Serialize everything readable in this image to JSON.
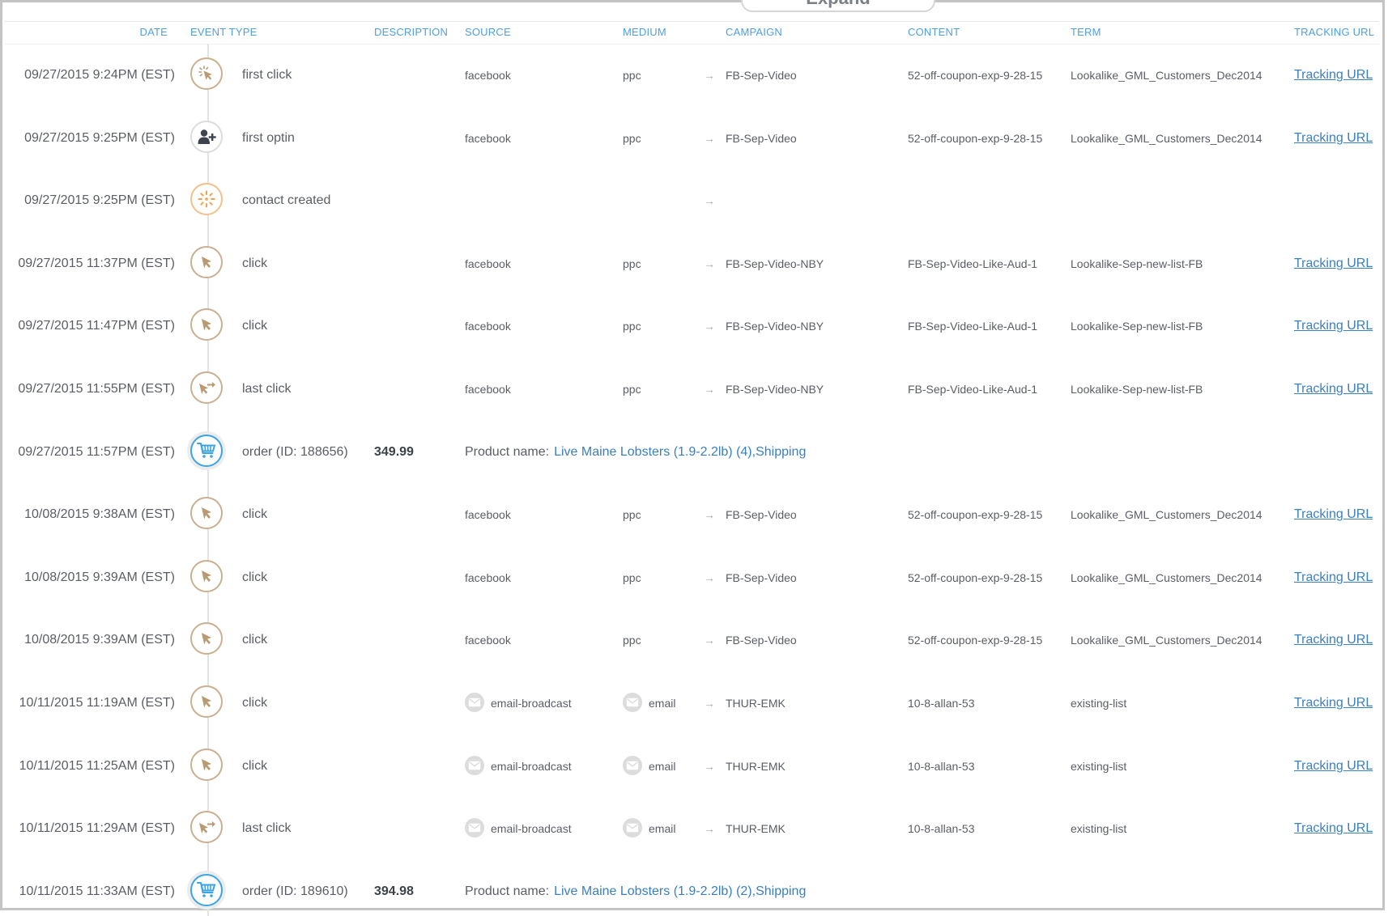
{
  "expand_button": {
    "label": "Expand"
  },
  "columns": {
    "date": "DATE",
    "event_type": "EVENT TYPE",
    "description": "DESCRIPTION",
    "source": "SOURCE",
    "medium": "MEDIUM",
    "campaign": "CAMPAIGN",
    "content": "CONTENT",
    "term": "TERM",
    "tracking_url": "TRACKING URL"
  },
  "colors": {
    "header_text": "#4f9fe0",
    "link": "#3a7fc0",
    "click_icon": "#b89a73",
    "contact_icon": "#f5a04a",
    "order_icon": "#3aa4e6",
    "optin_icon": "#3d4450"
  },
  "product_label": "Product name:",
  "tracking_url_label": "Tracking URL",
  "arrow_glyph": "→",
  "rows": [
    {
      "date": "09/27/2015 9:24PM (EST)",
      "icon": "first-click-icon",
      "event": "first click",
      "description": "",
      "source": "facebook",
      "source_icon": "",
      "medium": "ppc",
      "medium_icon": "",
      "campaign": "FB-Sep-Video",
      "content": "52-off-coupon-exp-9-28-15",
      "term": "Lookalike_GML_Customers_Dec2014",
      "tracking": "Tracking URL"
    },
    {
      "date": "09/27/2015 9:25PM (EST)",
      "icon": "add-user-icon",
      "event": "first optin",
      "description": "",
      "source": "facebook",
      "source_icon": "",
      "medium": "ppc",
      "medium_icon": "",
      "campaign": "FB-Sep-Video",
      "content": "52-off-coupon-exp-9-28-15",
      "term": "Lookalike_GML_Customers_Dec2014",
      "tracking": "Tracking URL"
    },
    {
      "date": "09/27/2015 9:25PM (EST)",
      "icon": "contact-created-icon",
      "event": "contact created",
      "description": "",
      "source": "",
      "source_icon": "",
      "medium": "",
      "medium_icon": "",
      "campaign": "",
      "content": "",
      "term": "",
      "tracking": ""
    },
    {
      "date": "09/27/2015 11:37PM (EST)",
      "icon": "cursor-click-icon",
      "event": "click",
      "description": "",
      "source": "facebook",
      "source_icon": "",
      "medium": "ppc",
      "medium_icon": "",
      "campaign": "FB-Sep-Video-NBY",
      "content": "FB-Sep-Video-Like-Aud-1",
      "term": "Lookalike-Sep-new-list-FB",
      "tracking": "Tracking URL"
    },
    {
      "date": "09/27/2015 11:47PM (EST)",
      "icon": "cursor-click-icon",
      "event": "click",
      "description": "",
      "source": "facebook",
      "source_icon": "",
      "medium": "ppc",
      "medium_icon": "",
      "campaign": "FB-Sep-Video-NBY",
      "content": "FB-Sep-Video-Like-Aud-1",
      "term": "Lookalike-Sep-new-list-FB",
      "tracking": "Tracking URL"
    },
    {
      "date": "09/27/2015 11:55PM (EST)",
      "icon": "last-click-icon",
      "event": "last click",
      "description": "",
      "source": "facebook",
      "source_icon": "",
      "medium": "ppc",
      "medium_icon": "",
      "campaign": "FB-Sep-Video-NBY",
      "content": "FB-Sep-Video-Like-Aud-1",
      "term": "Lookalike-Sep-new-list-FB",
      "tracking": "Tracking URL"
    },
    {
      "date": "09/27/2015 11:57PM (EST)",
      "icon": "shopping-cart-icon",
      "event": "order (ID: 188656)",
      "description": "349.99",
      "product": "Live Maine Lobsters (1.9-2.2lb) (4),Shipping"
    },
    {
      "date": "10/08/2015 9:38AM (EST)",
      "icon": "cursor-click-icon",
      "event": "click",
      "description": "",
      "source": "facebook",
      "source_icon": "",
      "medium": "ppc",
      "medium_icon": "",
      "campaign": "FB-Sep-Video",
      "content": "52-off-coupon-exp-9-28-15",
      "term": "Lookalike_GML_Customers_Dec2014",
      "tracking": "Tracking URL"
    },
    {
      "date": "10/08/2015 9:39AM (EST)",
      "icon": "cursor-click-icon",
      "event": "click",
      "description": "",
      "source": "facebook",
      "source_icon": "",
      "medium": "ppc",
      "medium_icon": "",
      "campaign": "FB-Sep-Video",
      "content": "52-off-coupon-exp-9-28-15",
      "term": "Lookalike_GML_Customers_Dec2014",
      "tracking": "Tracking URL"
    },
    {
      "date": "10/08/2015 9:39AM (EST)",
      "icon": "cursor-click-icon",
      "event": "click",
      "description": "",
      "source": "facebook",
      "source_icon": "",
      "medium": "ppc",
      "medium_icon": "",
      "campaign": "FB-Sep-Video",
      "content": "52-off-coupon-exp-9-28-15",
      "term": "Lookalike_GML_Customers_Dec2014",
      "tracking": "Tracking URL"
    },
    {
      "date": "10/11/2015 11:19AM (EST)",
      "icon": "cursor-click-icon",
      "event": "click",
      "description": "",
      "source": "email-broadcast",
      "source_icon": "envelope-icon",
      "medium": "email",
      "medium_icon": "envelope-icon",
      "campaign": "THUR-EMK",
      "content": "10-8-allan-53",
      "term": "existing-list",
      "tracking": "Tracking URL"
    },
    {
      "date": "10/11/2015 11:25AM (EST)",
      "icon": "cursor-click-icon",
      "event": "click",
      "description": "",
      "source": "email-broadcast",
      "source_icon": "envelope-icon",
      "medium": "email",
      "medium_icon": "envelope-icon",
      "campaign": "THUR-EMK",
      "content": "10-8-allan-53",
      "term": "existing-list",
      "tracking": "Tracking URL"
    },
    {
      "date": "10/11/2015 11:29AM (EST)",
      "icon": "last-click-icon",
      "event": "last click",
      "description": "",
      "source": "email-broadcast",
      "source_icon": "envelope-icon",
      "medium": "email",
      "medium_icon": "envelope-icon",
      "campaign": "THUR-EMK",
      "content": "10-8-allan-53",
      "term": "existing-list",
      "tracking": "Tracking URL"
    },
    {
      "date": "10/11/2015 11:33AM (EST)",
      "icon": "shopping-cart-icon",
      "event": "order (ID: 189610)",
      "description": "394.98",
      "product": "Live Maine Lobsters (1.9-2.2lb) (2),Shipping"
    }
  ]
}
